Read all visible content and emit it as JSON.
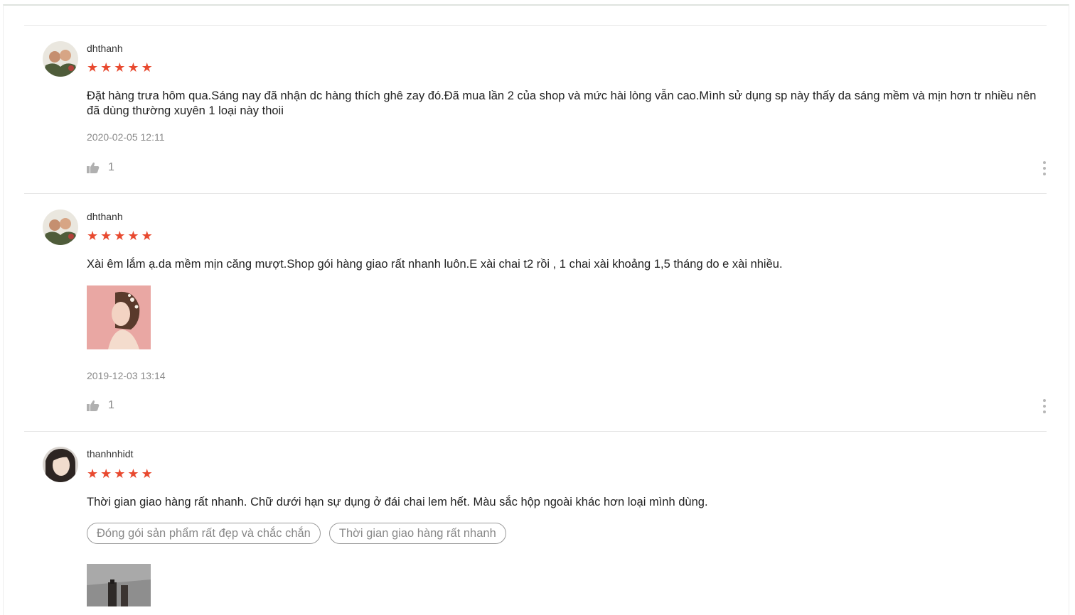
{
  "reviews": [
    {
      "username": "dhthanh",
      "rating": 5,
      "content": "Đặt hàng trưa hôm qua.Sáng nay đã nhận dc hàng thích ghê zay đó.Đã mua lần 2 của shop và mức hài lòng vẫn cao.Mình sử dụng sp này thấy da sáng mềm và mịn hơn tr nhiều nên đã dùng thường xuyên 1 loại này thoii",
      "time": "2020-02-05 12:11",
      "likes": "1"
    },
    {
      "username": "dhthanh",
      "rating": 5,
      "content": "Xài êm lắm ạ.da mềm mịn căng mượt.Shop gói hàng giao rất nhanh luôn.E xài chai t2 rồi , 1 chai xài khoảng 1,5 tháng do e xài nhiều.",
      "time": "2019-12-03 13:14",
      "likes": "1"
    },
    {
      "username": "thanhnhidt",
      "rating": 5,
      "content": "Thời gian giao hàng rất nhanh. Chữ dưới hạn sự dụng ở đái chai lem hết. Màu sắc hộp ngoài khác hơn loại mình dùng.",
      "tags": [
        "Đóng gói sản phẩm rất đẹp và chắc chắn",
        "Thời gian giao hàng rất nhanh"
      ]
    }
  ],
  "colors": {
    "star": "#e8492f",
    "muted": "#8a8a8a",
    "divider": "#e6e6e6"
  },
  "icons": {
    "rating": "star-icon",
    "like": "thumbs-up-icon",
    "more": "more-vertical-icon"
  }
}
